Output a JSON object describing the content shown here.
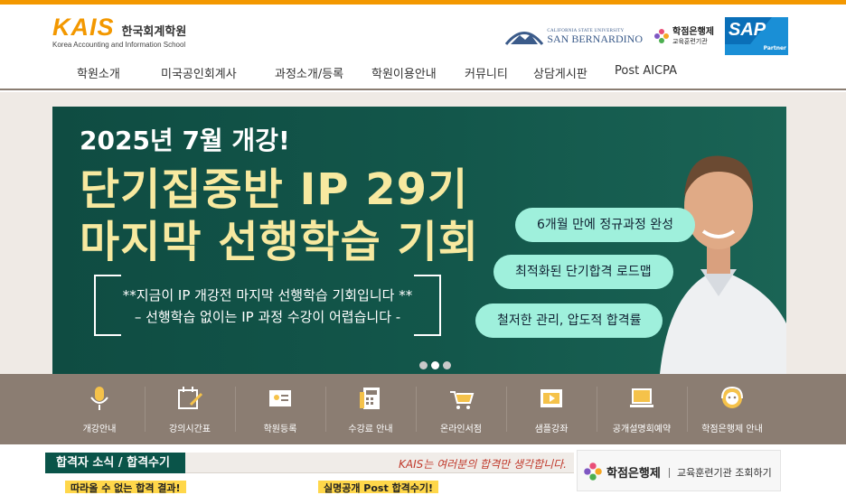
{
  "header": {
    "logo_main": "KAIS",
    "logo_kr": "한국회계학원",
    "logo_en": "Korea Accounting and Information School",
    "partner_csusb_small": "CALIFORNIA STATE UNIVERSITY",
    "partner_csusb_big": "SAN BERNARDINO",
    "partner_credit_title": "학점은행제",
    "partner_credit_sub": "교육훈련기관",
    "partner_sap": "SAP",
    "partner_sap_sub": "Partner"
  },
  "nav": {
    "items": [
      "학원소개",
      "미국공인회계사",
      "과정소개/등록",
      "학원이용안내",
      "커뮤니티",
      "상담게시판",
      "Post AICPA"
    ]
  },
  "banner": {
    "line1": "2025년 7월 개강!",
    "line2": "단기집중반 IP 29기",
    "line3": "마지막 선행학습 기회",
    "sub1": "**지금이 IP 개강전 마지막 선행학습 기회입니다 **",
    "sub2": "– 선행학습 없이는 IP 과정 수강이 어렵습니다 -",
    "pills": [
      "6개월 만에 정규과정 완성",
      "최적화된 단기합격 로드맵",
      "철저한 관리, 압도적 합격률"
    ],
    "slide_count": 3,
    "active_slide": 1
  },
  "quick_menu": {
    "items": [
      {
        "label": "개강안내",
        "icon": "microphone-icon"
      },
      {
        "label": "강의시간표",
        "icon": "calendar-icon"
      },
      {
        "label": "학원등록",
        "icon": "id-card-icon"
      },
      {
        "label": "수강료 안내",
        "icon": "calculator-icon"
      },
      {
        "label": "온라인서점",
        "icon": "cart-icon"
      },
      {
        "label": "샘플강좌",
        "icon": "video-icon"
      },
      {
        "label": "공개설명회예약",
        "icon": "laptop-icon"
      },
      {
        "label": "학점은행제 안내",
        "icon": "support-icon"
      }
    ]
  },
  "news": {
    "tab_label": "합격자 소식 / 합격수기",
    "slogan": "KAIS는 여러분의 합격만 생각합니다.",
    "tag_left": "따라올 수 없는 합격 결과!",
    "tag_right": "실명공개 Post 합격수기!"
  },
  "side": {
    "title": "학점은행제",
    "subtitle": "교육훈련기관 조회하기"
  },
  "colors": {
    "brand_orange": "#f39800",
    "banner_green": "#13574b",
    "accent_mint": "#9ff0dc",
    "headline_yellow": "#f7e9a0",
    "quick_bar": "#8b7d72"
  }
}
